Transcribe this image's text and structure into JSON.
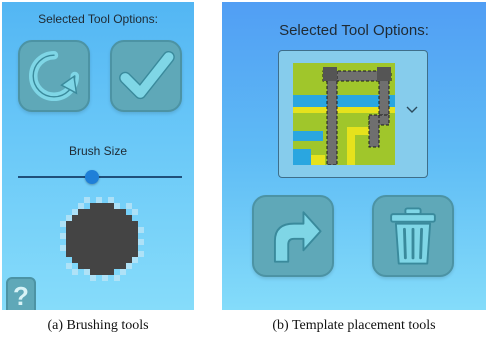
{
  "panel_a": {
    "title": "Selected Tool Options:",
    "brush_label": "Brush Size",
    "slider_level": 0.45,
    "help_label": "?",
    "caption": "(a)  Brushing tools"
  },
  "panel_b": {
    "title": "Selected Tool Options:",
    "caption": "(b)  Template placement tools"
  },
  "colors": {
    "tile_fill": "#5fa8b8",
    "tile_border": "#4c93a4",
    "icon_fill": "#7fd6e6",
    "slider_thumb": "#1e7fd8",
    "brush_dark": "#444444",
    "map_green": "#a0c62b",
    "map_yellow": "#e6e21c",
    "map_water": "#2aa6e0",
    "map_road": "#6f6f6f"
  },
  "icons": {
    "rotate": "rotate-arrow-icon",
    "confirm": "check-icon",
    "help": "question-mark-icon",
    "place": "curved-arrow-icon",
    "delete": "trash-icon",
    "dropdown": "chevron-down-icon"
  }
}
